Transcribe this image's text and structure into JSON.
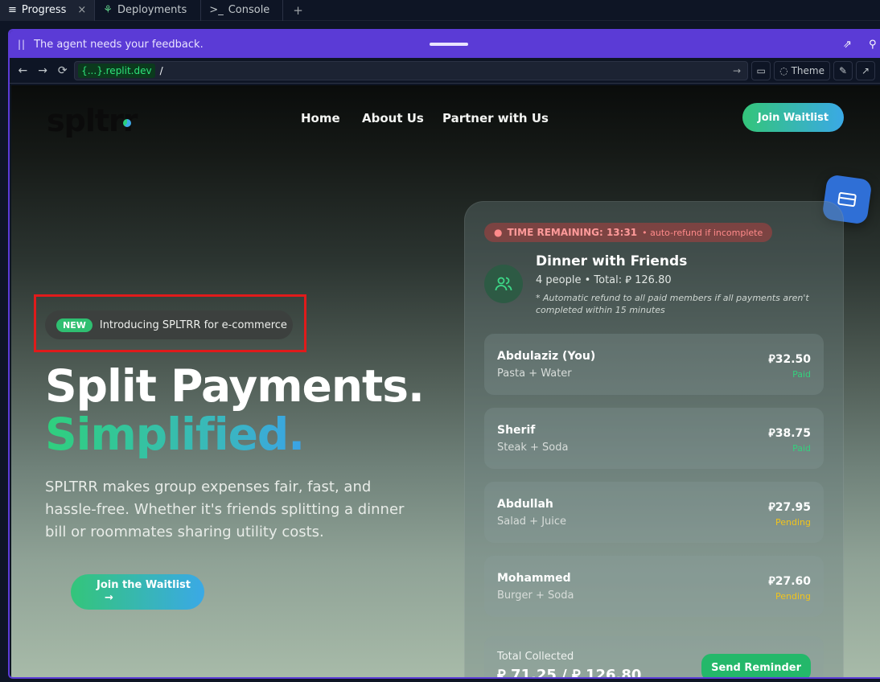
{
  "tabs": [
    {
      "label": "Progress",
      "icon": "progress-icon",
      "close": "×"
    },
    {
      "label": "Deployments",
      "icon": "deployments-icon"
    },
    {
      "label": "Console",
      "icon": "console-icon"
    }
  ],
  "tab_add": "+",
  "banner": {
    "pause": "||",
    "text": "The agent needs your feedback."
  },
  "urlbar": {
    "back": "←",
    "forward": "→",
    "refresh": "⟳",
    "domain": "{...}.replit.dev",
    "path": "/",
    "go": "→",
    "theme_label": "Theme"
  },
  "site": {
    "logo": "spltrr",
    "nav": [
      "Home",
      "About Us",
      "Partner with Us"
    ],
    "cta_top": "Join Waitlist",
    "pill": {
      "badge": "NEW",
      "text": "Introducing SPLTRR for e-commerce"
    },
    "headline_1": "Split Payments.",
    "headline_2": "Simplified.",
    "description": "SPLTRR makes group expenses fair, fast, and hassle-free. Whether it's friends splitting a dinner bill or roommates sharing utility costs.",
    "cta_main": "Join the Waitlist",
    "cta_arrow": "→"
  },
  "card": {
    "timer_label": "TIME REMAINING: 13:31",
    "timer_sub": "• auto-refund if incomplete",
    "title": "Dinner with Friends",
    "subtitle": "4 people • Total:  ⃁ 126.80",
    "note": "* Automatic refund to all paid members if all payments aren't completed within 15 minutes",
    "members": [
      {
        "name": "Abdulaziz (You)",
        "items": "Pasta + Water",
        "amount": "⃁32.50",
        "status": "Paid"
      },
      {
        "name": "Sherif",
        "items": "Steak + Soda",
        "amount": "⃁38.75",
        "status": "Paid"
      },
      {
        "name": "Abdullah",
        "items": "Salad + Juice",
        "amount": "⃁27.95",
        "status": "Pending"
      },
      {
        "name": "Mohammed",
        "items": "Burger + Soda",
        "amount": "⃁27.60",
        "status": "Pending"
      }
    ],
    "total_label": "Total Collected",
    "total_value": "⃁ 71.25 / ⃁ 126.80",
    "remind_button": "Send Reminder"
  }
}
